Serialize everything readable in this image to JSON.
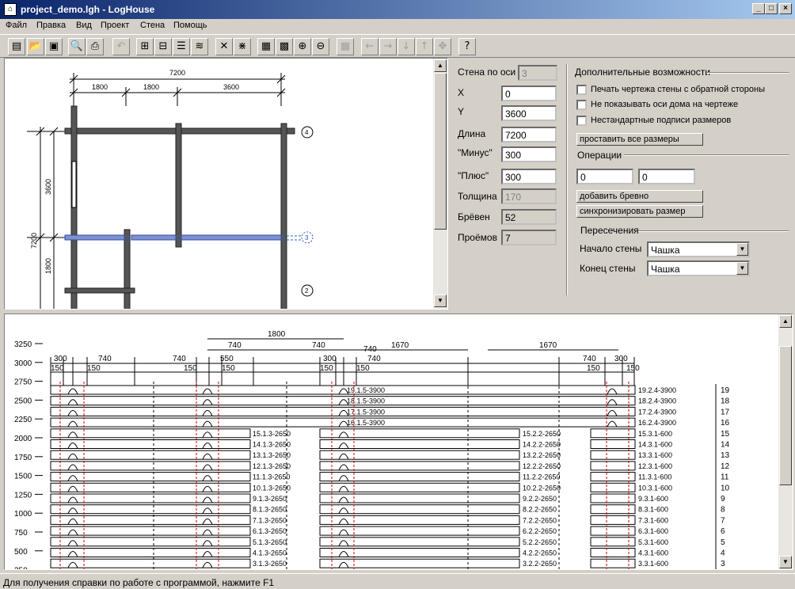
{
  "window": {
    "title": "project_demo.lgh - LogHouse",
    "min": "_",
    "max": "□",
    "close": "×"
  },
  "menu": [
    "Файл",
    "Правка",
    "Вид",
    "Проект",
    "Стена",
    "Помощь"
  ],
  "toolbar": {
    "buttons": [
      "new",
      "open",
      "save",
      "preview",
      "print",
      "undo",
      "wall-front",
      "wall-side",
      "wall-list",
      "wall-logs",
      "delete-wall",
      "split-wall",
      "logs-table-1",
      "logs-table-2",
      "zoom-in",
      "zoom-out",
      "grid",
      "arrow-left",
      "arrow-right",
      "arrow-down",
      "arrow-up",
      "center",
      "help"
    ]
  },
  "plan": {
    "top_total": "7200",
    "top_segments": [
      "1800",
      "1800",
      "3600"
    ],
    "left_total": "7200",
    "left_segments": [
      "3600",
      "1800"
    ],
    "axes": [
      "4",
      "3",
      "2"
    ]
  },
  "props": {
    "axis_label": "Стена по оси",
    "axis_value": "3",
    "x_label": "X",
    "x_value": "0",
    "y_label": "Y",
    "y_value": "3600",
    "length_label": "Длина",
    "length_value": "7200",
    "minus_label": "\"Минус\"",
    "minus_value": "300",
    "plus_label": "\"Плюс\"",
    "plus_value": "300",
    "thickness_label": "Толщина",
    "thickness_value": "170",
    "logs_label": "Брёвен",
    "logs_value": "52",
    "openings_label": "Проёмов",
    "openings_value": "7"
  },
  "extra": {
    "title": "Дополнительные возможности",
    "check1": "Печать чертежа стены с обратной стороны",
    "check2": "Не показывать оси дома на чертеже",
    "check3": "Нестандартные подписи размеров",
    "btn_sizes": "проставить все размеры",
    "ops_title": "Операции",
    "op1": "0",
    "op2": "0",
    "btn_add": "добавить бревно",
    "btn_sync": "синхронизировать размер",
    "cross_title": "Пересечения",
    "start_label": "Начало стены",
    "start_value": "Чашка",
    "end_label": "Конец стены",
    "end_value": "Чашка"
  },
  "log": {
    "yticks": [
      "3250",
      "3000",
      "2750",
      "2500",
      "2250",
      "2000",
      "1750",
      "1500",
      "1250",
      "1000",
      "750",
      "500",
      "250"
    ],
    "dims_top": [
      "1800"
    ],
    "dims_row2": [
      "740",
      "740",
      "740",
      "1670",
      "1670"
    ],
    "dims_row3": [
      "300",
      "740",
      "740",
      "550",
      "300",
      "740",
      "740",
      "300"
    ],
    "dims_row4": [
      "150",
      "150",
      "150",
      "150",
      "150",
      "150",
      "150",
      "150"
    ],
    "full_logs": [
      "19.1.5-3900",
      "18.1.5-3900",
      "17.1.5-3900",
      "16.1.5-3900"
    ],
    "right_full": [
      "19.2.4-3900",
      "18.2.4-3900",
      "17.2.4-3900",
      "16.2.4-3900"
    ],
    "col1": [
      "15.1.3-2650",
      "14.1.3-2650",
      "13.1.3-2650",
      "12.1.3-2650",
      "11.1.3-2650",
      "10.1.3-2650",
      "9.1.3-2650",
      "8.1.3-2650",
      "7.1.3-2650",
      "6.1.3-2650",
      "5.1.3-2650",
      "4.1.3-2650",
      "3.1.3-2650"
    ],
    "col2": [
      "15.2.2-2650",
      "14.2.2-2650",
      "13.2.2-2650",
      "12.2.2-2650",
      "11.2.2-2650",
      "10.2.2-2650",
      "9.2.2-2650",
      "8.2.2-2650",
      "7.2.2-2650",
      "6.2.2-2650",
      "5.2.2-2650",
      "4.2.2-2650",
      "3.2.2-2650"
    ],
    "col3": [
      "15.3.1-600",
      "14.3.1-600",
      "13.3.1-600",
      "12.3.1-600",
      "11.3.1-600",
      "10.3.1-600",
      "9.3.1-600",
      "8.3.1-600",
      "7.3.1-600",
      "6.3.1-600",
      "5.3.1-600",
      "4.3.1-600",
      "3.3.1-600"
    ],
    "row_numbers": [
      "19",
      "18",
      "17",
      "16",
      "15",
      "14",
      "13",
      "12",
      "11",
      "10",
      "9",
      "8",
      "7",
      "6",
      "5",
      "4",
      "3"
    ]
  },
  "status": "Для получения справки по работе с программой, нажмите F1"
}
